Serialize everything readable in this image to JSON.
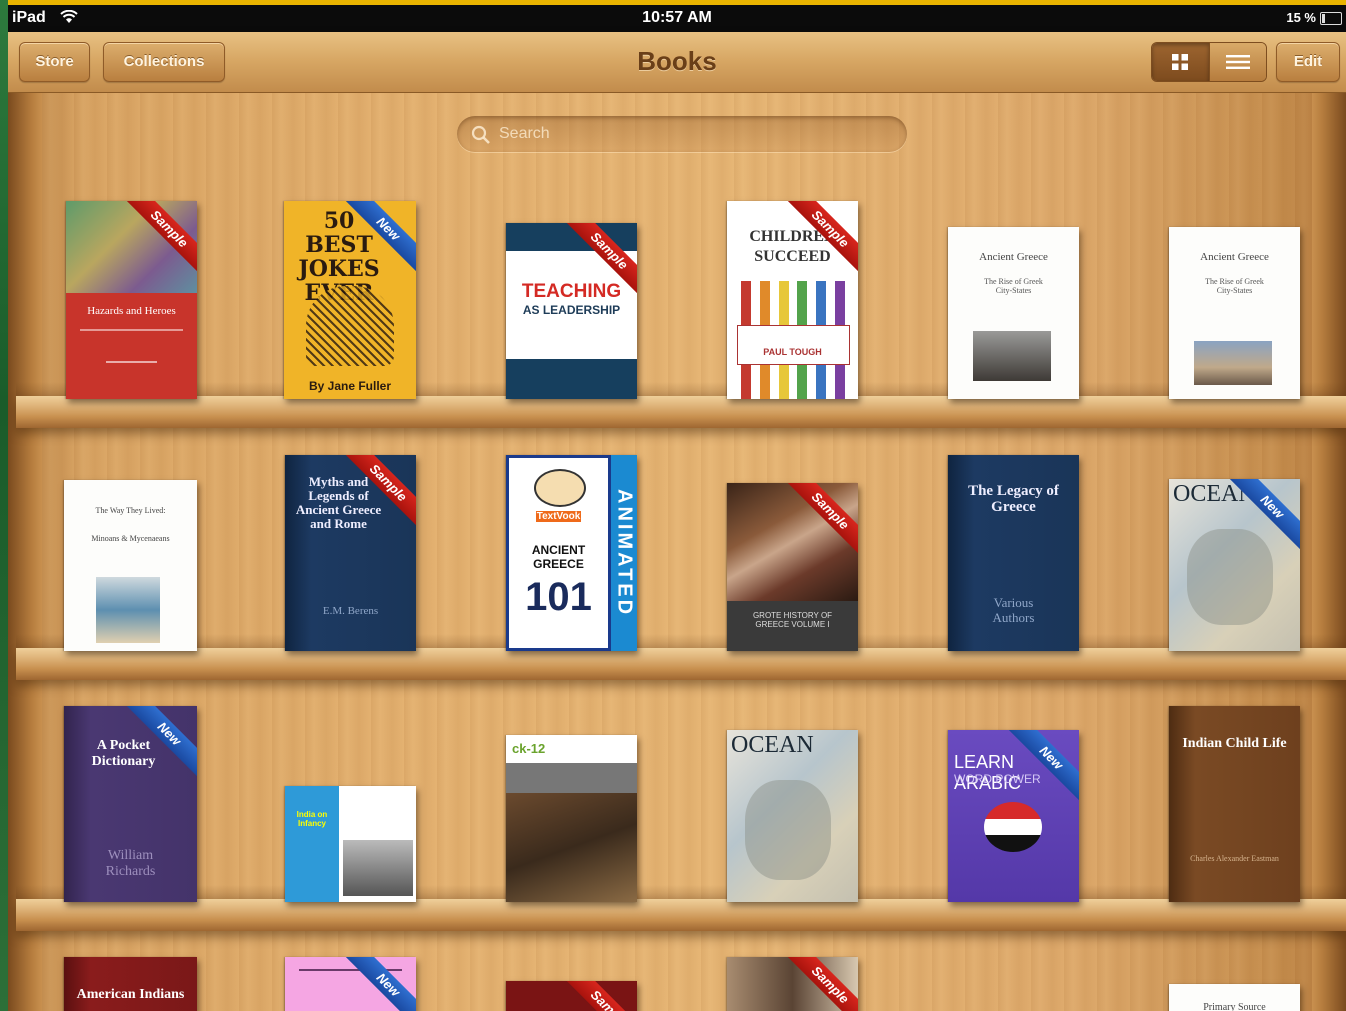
{
  "status": {
    "device": "iPad",
    "time": "10:57 AM",
    "battery": "15 %"
  },
  "nav": {
    "title": "Books",
    "store": "Store",
    "collections": "Collections",
    "edit": "Edit"
  },
  "search": {
    "placeholder": "Search"
  },
  "ribbons": {
    "sample": "Sample",
    "new": "New"
  },
  "books": {
    "b1": {
      "title": "Hazards and Heroes",
      "author": "",
      "ribbon": "Sample"
    },
    "b2": {
      "title": "50 BEST JOKES EVER",
      "author": "By Jane Fuller",
      "ribbon": "New"
    },
    "b3": {
      "title": "TEACHING",
      "subtitle": "AS LEADERSHIP",
      "ribbon": "Sample"
    },
    "b4": {
      "title": "CHILDREN SUCCEED",
      "author": "PAUL TOUGH",
      "ribbon": "Sample"
    },
    "b5": {
      "title": "Ancient Greece",
      "subtitle": "The Rise of Greek City-States"
    },
    "b6": {
      "title": "Ancient Greece",
      "subtitle": "The Rise of Greek City-States"
    },
    "b7": {
      "title": "The Way They Lived:",
      "subtitle": "Minoans & Mycenaeans"
    },
    "b8": {
      "title": "Myths and Legends of Ancient Greece and Rome",
      "author": "E.M. Berens",
      "ribbon": "Sample"
    },
    "b9": {
      "title": "ANCIENT GREECE",
      "number": "101",
      "side": "ANIMATED",
      "brand": "TextVook"
    },
    "b10": {
      "title": "GROTE HISTORY OF GREECE VOLUME I",
      "ribbon": "Sample"
    },
    "b11": {
      "title": "The Legacy of Greece",
      "author": "Various Authors"
    },
    "b12": {
      "title": "OCEAN",
      "ribbon": "New"
    },
    "b13": {
      "title": "A Pocket Dictionary",
      "author": "William Richards",
      "ribbon": "New"
    },
    "b14": {
      "title": "India on Infancy"
    },
    "b15": {
      "title": "ck-12"
    },
    "b16": {
      "title": "OCEAN"
    },
    "b17": {
      "title": "LEARN ARABIC",
      "subtitle": "WORD POWER",
      "ribbon": "New"
    },
    "b18": {
      "title": "Indian Child Life",
      "author": "Charles Alexander Eastman"
    },
    "b19": {
      "title": "American Indians"
    },
    "b20": {
      "title": "",
      "ribbon": "New"
    },
    "b21": {
      "title": "",
      "ribbon": "Sample"
    },
    "b22": {
      "title": "",
      "ribbon": "Sample"
    },
    "b23": {
      "title": "Primary Source"
    }
  },
  "colors": {
    "navbar": "#d8a865",
    "shelf": "#dfb47a",
    "sample_ribbon": "#c41c14",
    "new_ribbon": "#2660c0",
    "title_text": "#6a3f18"
  }
}
